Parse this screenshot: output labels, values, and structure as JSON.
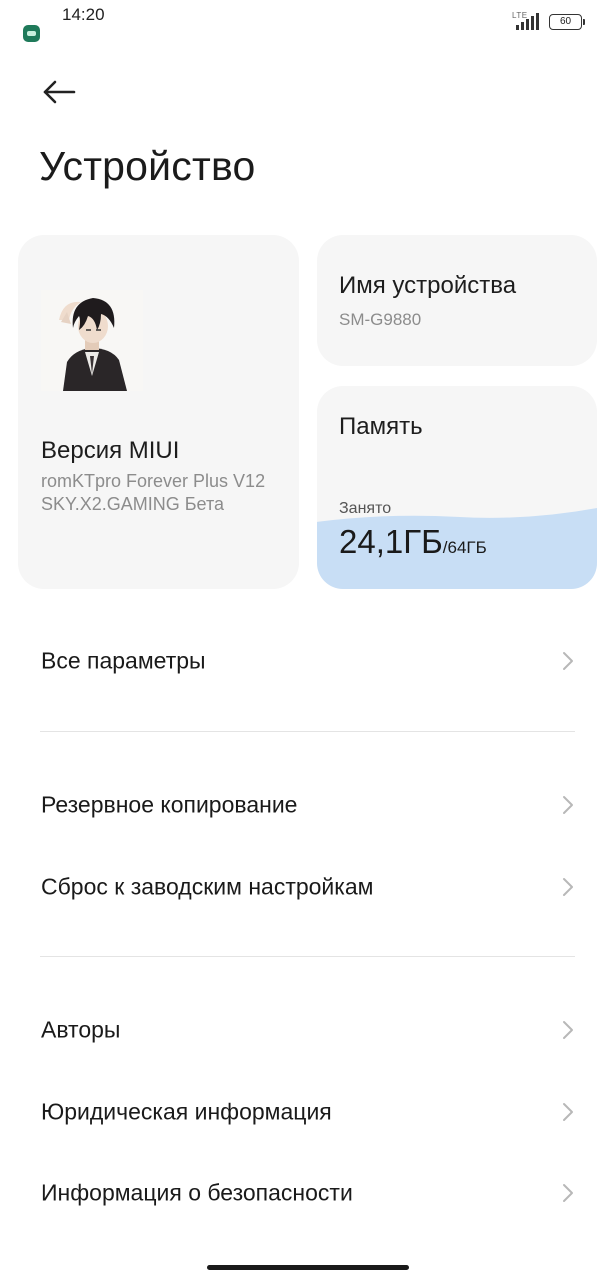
{
  "status_bar": {
    "time": "14:20",
    "network": "LTE",
    "battery": "60",
    "icons": [
      "app-notification-icon",
      "signal-icon",
      "battery-icon"
    ]
  },
  "header": {
    "back_icon": "arrow-left-icon",
    "title": "Устройство"
  },
  "cards": {
    "version": {
      "logo_icon": "miui-logo-image",
      "heading": "Версия MIUI",
      "line1": "romKTpro Forever Plus V12",
      "line2": "SKY.X2.GAMING Бета"
    },
    "device": {
      "heading": "Имя устройства",
      "value": "SM-G9880"
    },
    "storage": {
      "heading": "Память",
      "used_label": "Занято",
      "used": "24,1ГБ",
      "total": "/64ГБ",
      "used_fraction": 0.377,
      "fill_color": "#c8def5"
    }
  },
  "menu": [
    {
      "label": "Все параметры"
    },
    {
      "label": "Резервное копирование"
    },
    {
      "label": "Сброс к заводским настройкам"
    },
    {
      "label": "Авторы"
    },
    {
      "label": "Юридическая информация"
    },
    {
      "label": "Информация о безопасности"
    }
  ],
  "colors": {
    "background": "#ffffff",
    "card": "#f6f6f6",
    "storage_fill": "#c8def5",
    "chevron": "#b8b8b8"
  }
}
